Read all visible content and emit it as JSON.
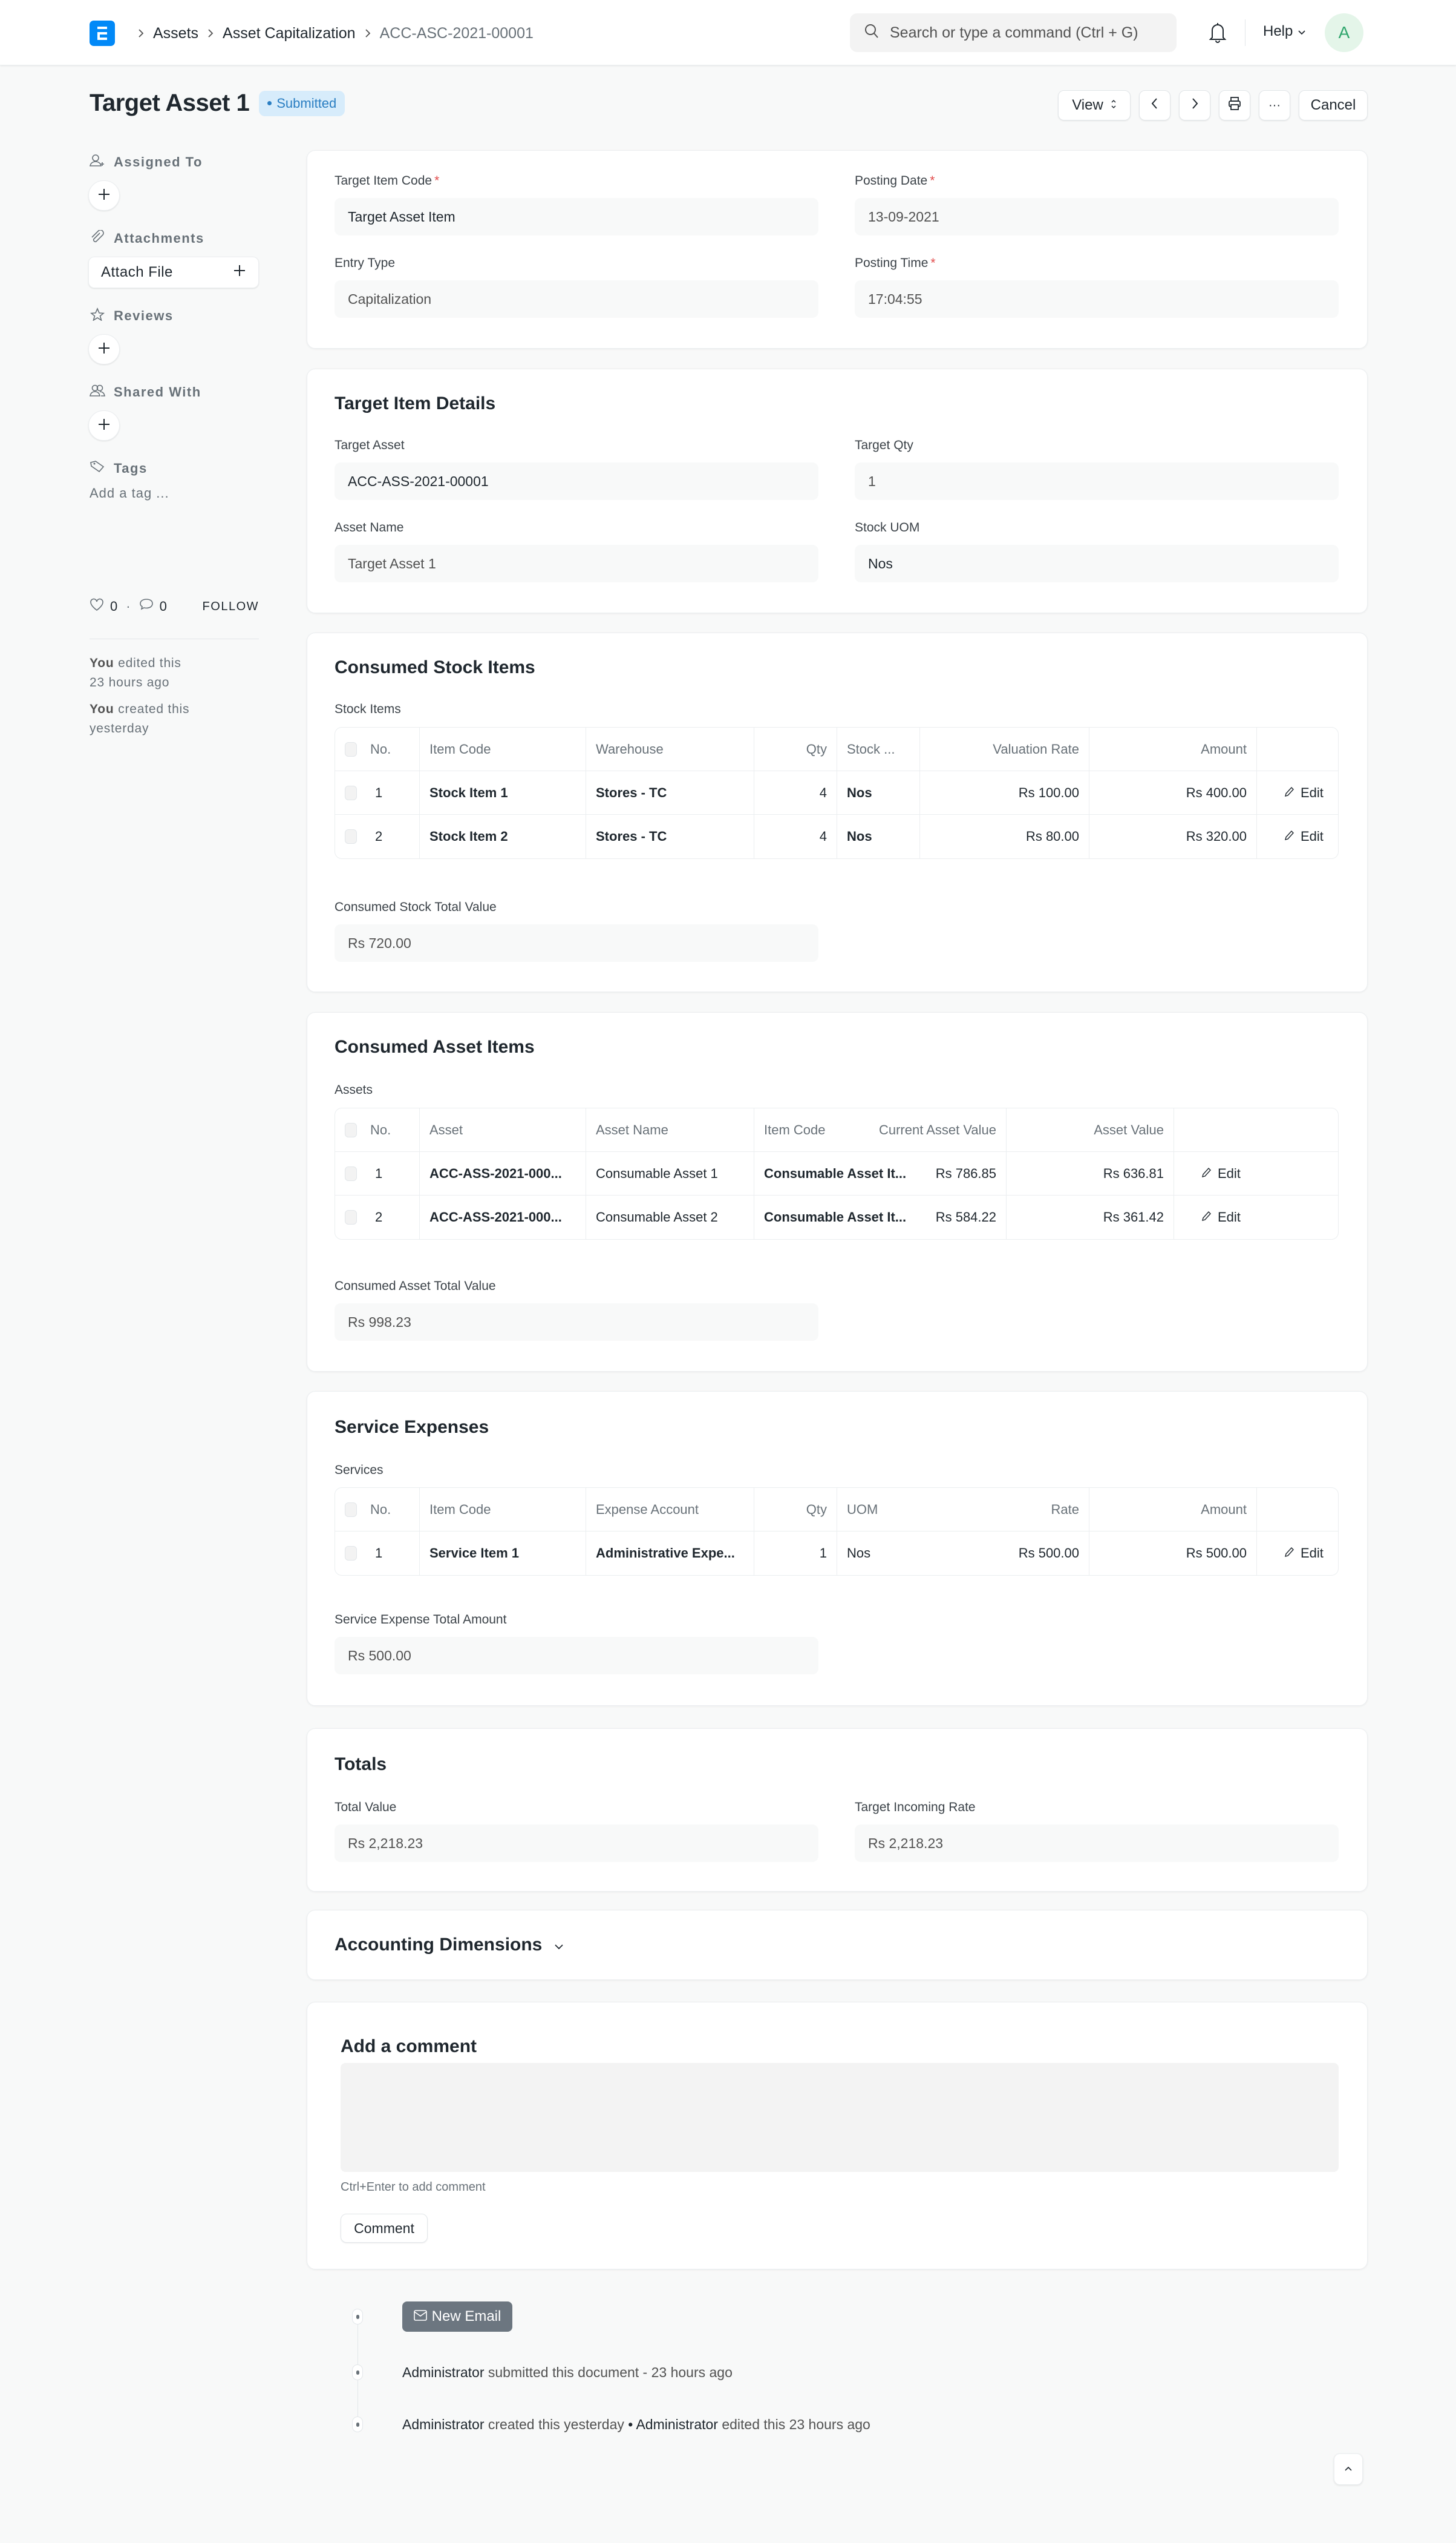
{
  "navbar": {
    "breadcrumbs": [
      "Assets",
      "Asset Capitalization",
      "ACC-ASC-2021-00001"
    ],
    "search_placeholder": "Search or type a command (Ctrl + G)",
    "help_label": "Help",
    "avatar_initial": "A"
  },
  "header": {
    "title": "Target Asset 1",
    "status": "Submitted",
    "view_label": "View",
    "cancel_label": "Cancel"
  },
  "sidebar": {
    "assigned_to": "Assigned To",
    "attachments": "Attachments",
    "attach_file": "Attach File",
    "reviews": "Reviews",
    "shared_with": "Shared With",
    "tags": "Tags",
    "add_tag": "Add a tag ...",
    "likes_count": "0",
    "comments_count": "0",
    "follow_label": "FOLLOW",
    "activity": [
      {
        "user": "You",
        "text": "edited this 23 hours ago"
      },
      {
        "user": "You",
        "text": "created this yesterday"
      }
    ]
  },
  "details": {
    "target_item_code": {
      "label": "Target Item Code",
      "value": "Target Asset Item"
    },
    "posting_date": {
      "label": "Posting Date",
      "value": "13-09-2021"
    },
    "entry_type": {
      "label": "Entry Type",
      "value": "Capitalization"
    },
    "posting_time": {
      "label": "Posting Time",
      "value": "17:04:55"
    }
  },
  "target_item_details": {
    "title": "Target Item Details",
    "target_asset": {
      "label": "Target Asset",
      "value": "ACC-ASS-2021-00001"
    },
    "target_qty": {
      "label": "Target Qty",
      "value": "1"
    },
    "asset_name": {
      "label": "Asset Name",
      "value": "Target Asset 1"
    },
    "stock_uom": {
      "label": "Stock UOM",
      "value": "Nos"
    }
  },
  "consumed_stock": {
    "title": "Consumed Stock Items",
    "table_label": "Stock Items",
    "columns": [
      "No.",
      "Item Code",
      "Warehouse",
      "Qty",
      "Stock ...",
      "Valuation Rate",
      "Amount"
    ],
    "rows": [
      {
        "no": "1",
        "item_code": "Stock Item 1",
        "warehouse": "Stores - TC",
        "qty": "4",
        "uom": "Nos",
        "rate": "Rs 100.00",
        "amount": "Rs 400.00"
      },
      {
        "no": "2",
        "item_code": "Stock Item 2",
        "warehouse": "Stores - TC",
        "qty": "4",
        "uom": "Nos",
        "rate": "Rs 80.00",
        "amount": "Rs 320.00"
      }
    ],
    "total_label": "Consumed Stock Total Value",
    "total_value": "Rs 720.00"
  },
  "consumed_assets": {
    "title": "Consumed Asset Items",
    "table_label": "Assets",
    "columns": [
      "No.",
      "Asset",
      "Asset Name",
      "Item Code",
      "Current Asset Value",
      "Asset Value"
    ],
    "rows": [
      {
        "no": "1",
        "asset": "ACC-ASS-2021-000...",
        "asset_name": "Consumable Asset 1",
        "item_code": "Consumable Asset It...",
        "current_value": "Rs 786.85",
        "asset_value": "Rs 636.81"
      },
      {
        "no": "2",
        "asset": "ACC-ASS-2021-000...",
        "asset_name": "Consumable Asset 2",
        "item_code": "Consumable Asset It...",
        "current_value": "Rs 584.22",
        "asset_value": "Rs 361.42"
      }
    ],
    "total_label": "Consumed Asset Total Value",
    "total_value": "Rs 998.23"
  },
  "service_expenses": {
    "title": "Service Expenses",
    "table_label": "Services",
    "columns": [
      "No.",
      "Item Code",
      "Expense Account",
      "Qty",
      "UOM",
      "Rate",
      "Amount"
    ],
    "rows": [
      {
        "no": "1",
        "item_code": "Service Item 1",
        "expense_account": "Administrative Expe...",
        "qty": "1",
        "uom": "Nos",
        "rate": "Rs 500.00",
        "amount": "Rs 500.00"
      }
    ],
    "total_label": "Service Expense Total Amount",
    "total_value": "Rs 500.00"
  },
  "totals": {
    "title": "Totals",
    "total_value": {
      "label": "Total Value",
      "value": "Rs 2,218.23"
    },
    "target_incoming_rate": {
      "label": "Target Incoming Rate",
      "value": "Rs 2,218.23"
    }
  },
  "accounting_dimensions": {
    "title": "Accounting Dimensions"
  },
  "edit_label": "Edit",
  "comment": {
    "title": "Add a comment",
    "hint": "Ctrl+Enter to add comment",
    "button": "Comment"
  },
  "timeline": {
    "new_email": "New Email",
    "events": [
      {
        "user": "Administrator",
        "text": "submitted this document - 23 hours ago"
      },
      {
        "user": "Administrator",
        "text": "created this yesterday",
        "sep": " • ",
        "user2": "Administrator",
        "text2": "edited this 23 hours ago"
      }
    ]
  }
}
